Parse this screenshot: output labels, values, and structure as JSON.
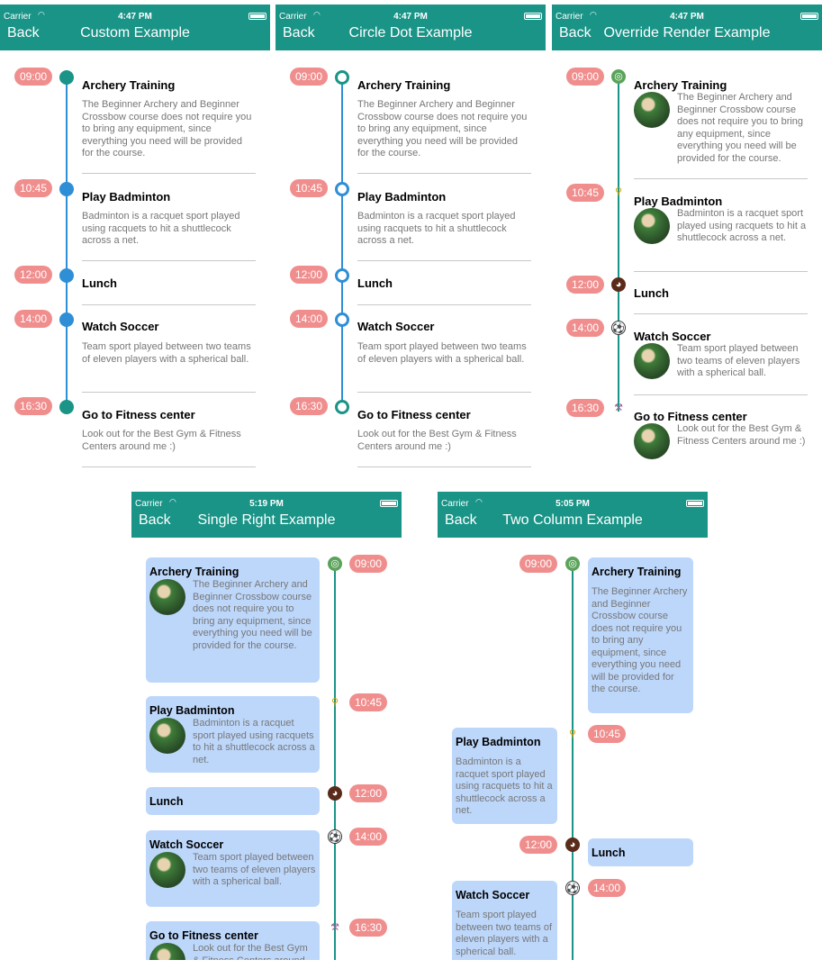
{
  "screens": [
    {
      "carrier": "Carrier",
      "time": "4:47 PM",
      "back": "Back",
      "title": "Custom Example"
    },
    {
      "carrier": "Carrier",
      "time": "4:47 PM",
      "back": "Back",
      "title": "Circle Dot Example"
    },
    {
      "carrier": "Carrier",
      "time": "4:47 PM",
      "back": "Back",
      "title": "Override Render Example"
    },
    {
      "carrier": "Carrier",
      "time": "5:19 PM",
      "back": "Back",
      "title": "Single Right Example"
    },
    {
      "carrier": "Carrier",
      "time": "5:05 PM",
      "back": "Back",
      "title": "Two Column Example"
    }
  ],
  "events": [
    {
      "time": "09:00",
      "title": "Archery Training",
      "desc": "The Beginner Archery and Beginner Crossbow course does not require you to bring any equipment, since everything you need will be provided for the course.",
      "icon": "archery-icon"
    },
    {
      "time": "10:45",
      "title": "Play Badminton",
      "desc": "Badminton is a racquet sport played using racquets to hit a shuttlecock across a net.",
      "icon": "badminton-icon"
    },
    {
      "time": "12:00",
      "title": "Lunch",
      "desc": "",
      "icon": "lunch-icon"
    },
    {
      "time": "14:00",
      "title": "Watch Soccer",
      "desc": "Team sport played between two teams of eleven players with a spherical ball.",
      "icon": "soccer-icon"
    },
    {
      "time": "16:30",
      "title": "Go to Fitness center",
      "desc": "Look out for the Best Gym & Fitness Centers around me :)",
      "icon": "fitness-icon"
    }
  ],
  "colors": {
    "nav": "#1a9487",
    "time_pill": "#f08e8e",
    "line_blue": "#2e8ed6",
    "line_teal": "#1a9487",
    "card": "#bdd7fb",
    "custom_dot_green": "#1a9487",
    "custom_dot_blue": "#2e8ed6"
  }
}
